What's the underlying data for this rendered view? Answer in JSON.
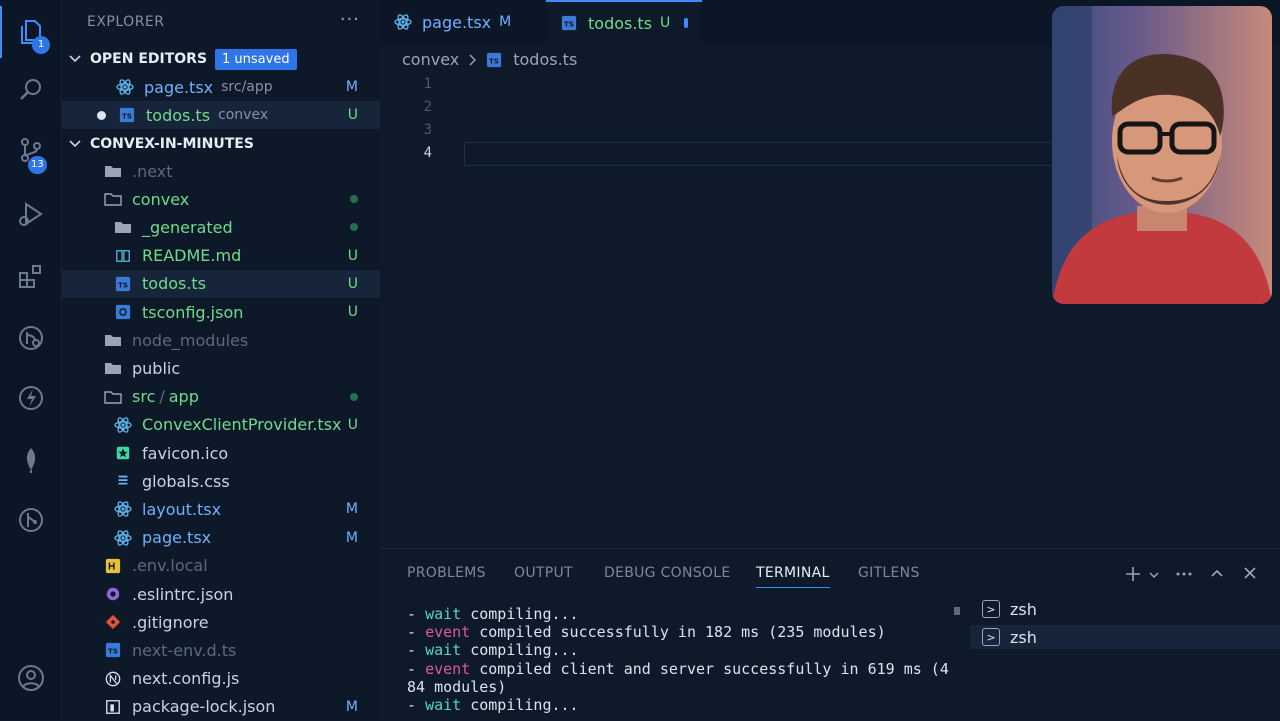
{
  "activity_bar": {
    "explorer_badge": "1",
    "source_control_badge": "13"
  },
  "sidebar": {
    "title": "EXPLORER",
    "more": "···",
    "open_editors": {
      "label": "OPEN EDITORS",
      "unsaved_pill": "1 unsaved",
      "items": [
        {
          "name": "page.tsx",
          "desc": "src/app",
          "status": "M"
        },
        {
          "name": "todos.ts",
          "desc": "convex",
          "status": "U"
        }
      ]
    },
    "project": {
      "label": "CONVEX-IN-MINUTES",
      "items": [
        {
          "name": ".next",
          "status": ""
        },
        {
          "name": "convex",
          "status": ""
        },
        {
          "name": "_generated",
          "status": ""
        },
        {
          "name": "README.md",
          "status": "U"
        },
        {
          "name": "todos.ts",
          "status": "U"
        },
        {
          "name": "tsconfig.json",
          "status": "U"
        },
        {
          "name": "node_modules",
          "status": ""
        },
        {
          "name": "public",
          "status": ""
        },
        {
          "name": "src",
          "sep": "/",
          "name2": "app",
          "status": ""
        },
        {
          "name": "ConvexClientProvider.tsx",
          "status": "U"
        },
        {
          "name": "favicon.ico",
          "status": ""
        },
        {
          "name": "globals.css",
          "status": ""
        },
        {
          "name": "layout.tsx",
          "status": "M"
        },
        {
          "name": "page.tsx",
          "status": "M"
        },
        {
          "name": ".env.local",
          "status": ""
        },
        {
          "name": ".eslintrc.json",
          "status": ""
        },
        {
          "name": ".gitignore",
          "status": ""
        },
        {
          "name": "next-env.d.ts",
          "status": ""
        },
        {
          "name": "next.config.js",
          "status": ""
        },
        {
          "name": "package-lock.json",
          "status": "M"
        }
      ]
    }
  },
  "tabs": [
    {
      "label": "page.tsx",
      "status": "M"
    },
    {
      "label": "todos.ts",
      "status": "U"
    }
  ],
  "breadcrumb": {
    "folder": "convex",
    "file": "todos.ts"
  },
  "editor": {
    "line_numbers": [
      "1",
      "2",
      "3",
      "4"
    ]
  },
  "panel": {
    "tabs": [
      "PROBLEMS",
      "OUTPUT",
      "DEBUG CONSOLE",
      "TERMINAL",
      "GITLENS"
    ],
    "terminal_lines": [
      {
        "dash": "- ",
        "kw": "wait",
        "text": " compiling..."
      },
      {
        "dash": "- ",
        "kw": "event",
        "text": " compiled successfully in 182 ms (235 modules)"
      },
      {
        "dash": "- ",
        "kw": "wait",
        "text": " compiling..."
      },
      {
        "dash": "- ",
        "kw": "event",
        "text": " compiled client and server successfully in 619 ms (4\n84 modules)"
      },
      {
        "dash": "- ",
        "kw": "wait",
        "text": " compiling..."
      }
    ],
    "shells": [
      "zsh",
      "zsh"
    ]
  },
  "colors": {
    "accent": "#3f8cff",
    "untracked": "#6fdc8c",
    "modified": "#6fb0ff"
  }
}
